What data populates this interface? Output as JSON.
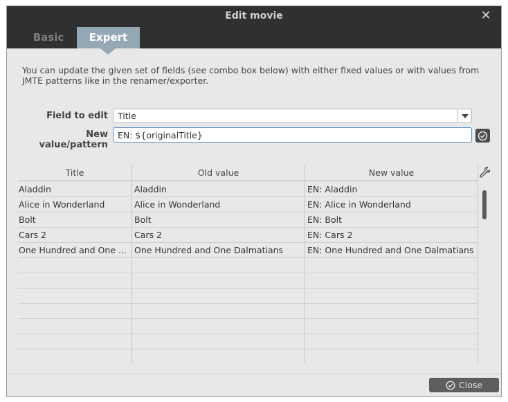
{
  "window": {
    "title": "Edit movie"
  },
  "tabs": [
    {
      "label": "Basic",
      "active": false
    },
    {
      "label": "Expert",
      "active": true
    }
  ],
  "description": "You can update the given set of fields (see combo box below) with either fixed values or with values from JMTE patterns like in the renamer/exporter.",
  "form": {
    "field_label": "Field to edit",
    "field_value": "Title",
    "pattern_label": "New value/pattern",
    "pattern_value": "EN: ${originalTitle}"
  },
  "table": {
    "columns": [
      "Title",
      "Old value",
      "New value"
    ],
    "rows": [
      [
        "Aladdin",
        "Aladdin",
        "EN: Aladdin"
      ],
      [
        "Alice in Wonderland",
        "Alice in Wonderland",
        "EN: Alice in Wonderland"
      ],
      [
        "Bolt",
        "Bolt",
        "EN: Bolt"
      ],
      [
        "Cars 2",
        "Cars 2",
        "EN: Cars 2"
      ],
      [
        "One Hundred and One ...",
        "One Hundred and One Dalmatians",
        "EN: One Hundred and One Dalmatians"
      ]
    ],
    "empty_rows": 7
  },
  "footer": {
    "close_label": "Close"
  },
  "colors": {
    "titlebar": "#2e3032",
    "active_tab": "#95a8b5",
    "input_focus": "#5b8fc4"
  },
  "icons": {
    "close": "close-icon",
    "apply": "check-circle-icon",
    "table_settings": "wrench-icon"
  }
}
